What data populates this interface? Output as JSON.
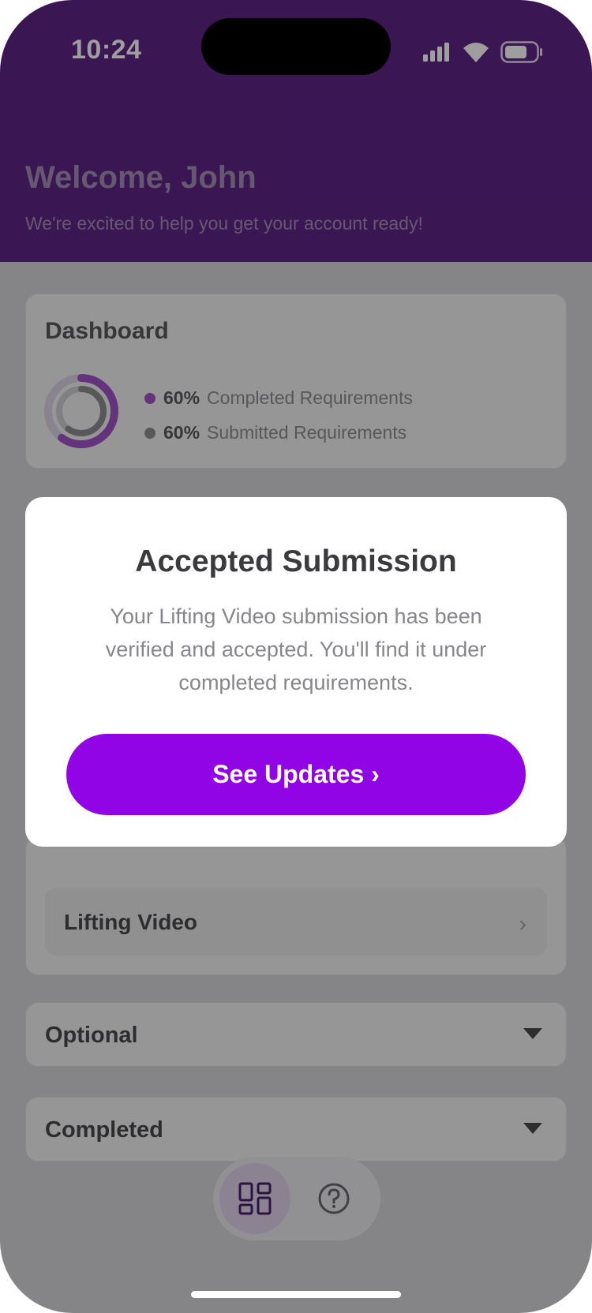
{
  "status_bar": {
    "time": "10:24"
  },
  "header": {
    "welcome": "Welcome, John",
    "tagline": "We're excited to help you get your account ready!"
  },
  "dashboard": {
    "title": "Dashboard",
    "completed": {
      "percent": "60%",
      "label": "Completed Requirements",
      "color": "#a054c8"
    },
    "submitted": {
      "percent": "60%",
      "label": "Submitted Requirements",
      "color": "#8e8e94"
    }
  },
  "requirements": {
    "item_label": "Lifting Video"
  },
  "sections": {
    "optional": "Optional",
    "completed": "Completed"
  },
  "modal": {
    "title": "Accepted Submission",
    "body": "Your Lifting Video submission has been verified and accepted. You'll find it under completed requirements.",
    "button_label": "See Updates ›"
  },
  "colors": {
    "header_bg": "#5e2587",
    "button_bg": "#9104e6"
  },
  "icons": [
    "signal-icon",
    "wifi-icon",
    "battery-icon",
    "chevron-right-icon",
    "caret-down-icon",
    "dashboard-grid-icon",
    "help-icon"
  ]
}
